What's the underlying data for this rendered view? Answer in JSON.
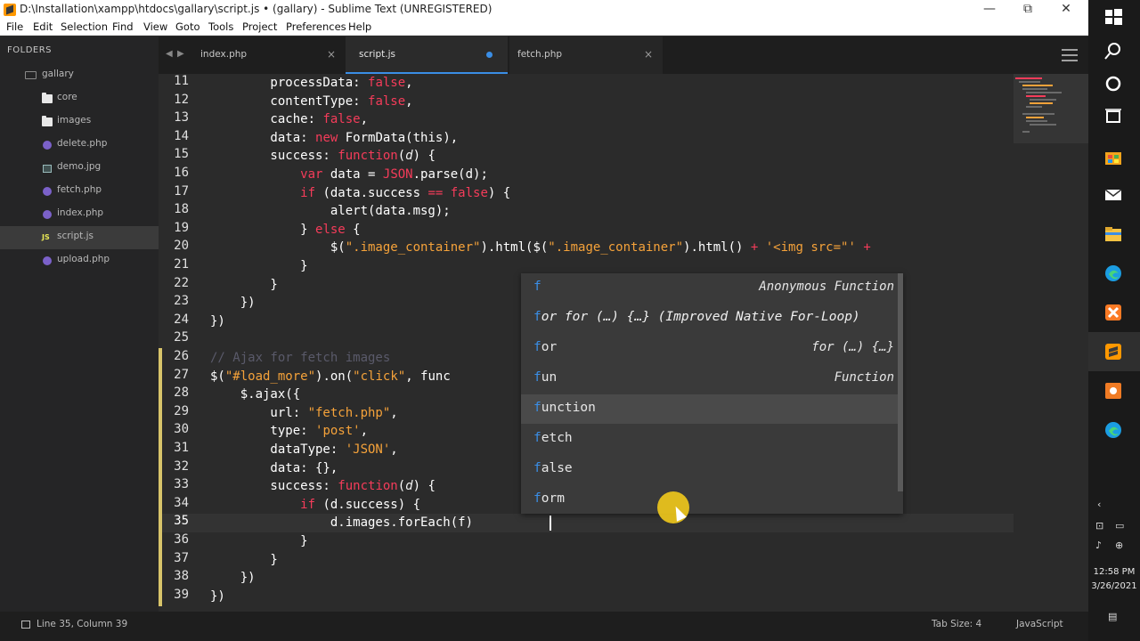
{
  "window": {
    "title": "D:\\Installation\\xampp\\htdocs\\gallary\\script.js • (gallary) - Sublime Text (UNREGISTERED)",
    "minimize": "—",
    "restore": "⧉",
    "close": "✕"
  },
  "menu": [
    "File",
    "Edit",
    "Selection",
    "Find",
    "View",
    "Goto",
    "Tools",
    "Project",
    "Preferences",
    "Help"
  ],
  "sidebar": {
    "header": "FOLDERS",
    "items": [
      {
        "label": "gallary",
        "icon": "folder-open-icon"
      },
      {
        "label": "core",
        "icon": "folder-icon"
      },
      {
        "label": "images",
        "icon": "folder-icon"
      },
      {
        "label": "delete.php",
        "icon": "php-file-icon"
      },
      {
        "label": "demo.jpg",
        "icon": "image-file-icon"
      },
      {
        "label": "fetch.php",
        "icon": "php-file-icon"
      },
      {
        "label": "index.php",
        "icon": "php-file-icon"
      },
      {
        "label": "script.js",
        "icon": "js-file-icon",
        "js_badge": "JS"
      },
      {
        "label": "upload.php",
        "icon": "php-file-icon"
      }
    ]
  },
  "tabs": [
    {
      "label": "index.php",
      "close": "×"
    },
    {
      "label": "script.js",
      "modified": true
    },
    {
      "label": "fetch.php",
      "close": "×"
    }
  ],
  "editor": {
    "line_numbers": [
      "11",
      "12",
      "13",
      "14",
      "15",
      "16",
      "17",
      "18",
      "19",
      "20",
      "21",
      "22",
      "23",
      "24",
      "25",
      "26",
      "27",
      "28",
      "29",
      "30",
      "31",
      "32",
      "33",
      "34",
      "35",
      "36",
      "37",
      "38",
      "39"
    ],
    "current_line": "35"
  },
  "autocomplete": {
    "items": [
      {
        "match": "f",
        "rest": "",
        "hint": "Anonymous Function"
      },
      {
        "match": "f",
        "rest": "or for (…) {…} (Improved Native For-Loop)",
        "hint": ""
      },
      {
        "match": "f",
        "rest": "or",
        "hint": "for (…) {…}"
      },
      {
        "match": "f",
        "rest": "un",
        "hint": "Function"
      },
      {
        "match": "f",
        "rest": "unction",
        "hint": "",
        "selected": true
      },
      {
        "match": "f",
        "rest": "etch",
        "hint": ""
      },
      {
        "match": "f",
        "rest": "alse",
        "hint": ""
      },
      {
        "match": "f",
        "rest": "orm",
        "hint": ""
      }
    ]
  },
  "status": {
    "position": "Line 35, Column 39",
    "tab_size": "Tab Size: 4",
    "syntax": "JavaScript"
  },
  "clock": {
    "time": "12:58 PM",
    "date": "3/26/2021"
  },
  "colors": {
    "keyword": "#f53c5a",
    "string": "#f5a23a",
    "accent": "#3a8ee6",
    "editor_bg": "#2b2b2b"
  }
}
